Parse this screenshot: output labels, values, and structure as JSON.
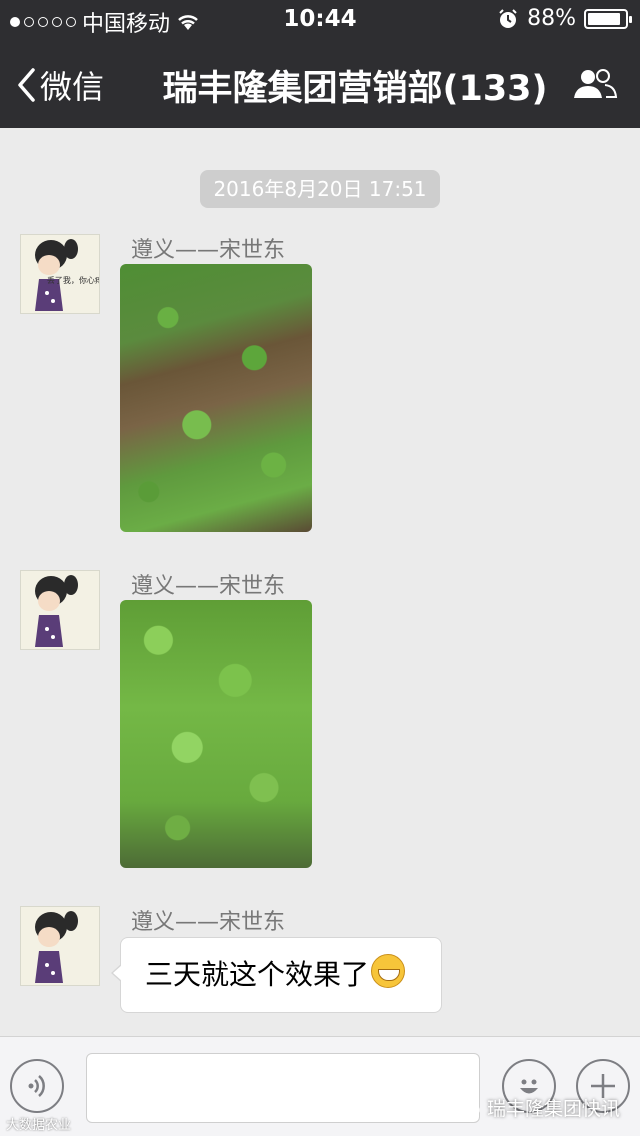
{
  "status_bar": {
    "carrier": "中国移动",
    "time": "10:44",
    "battery_percent": "88%",
    "battery_level": 0.88,
    "icons": [
      "signal-dots",
      "wifi-icon",
      "alarm-icon",
      "battery-icon"
    ]
  },
  "nav": {
    "back_label": "微信",
    "title": "瑞丰隆集团营销部(133)",
    "right_icon": "group-members-icon"
  },
  "chat": {
    "timestamp": "2016年8月20日 17:51",
    "messages": [
      {
        "sender": "遵义——宋世东",
        "type": "image",
        "image_desc": "seedlings-in-soil-photo"
      },
      {
        "sender": "遵义——宋世东",
        "type": "image",
        "image_desc": "dense-greens-photo"
      },
      {
        "sender": "遵义——宋世东",
        "type": "text",
        "text": "三天就这个效果了",
        "emoji": "grin-emoji"
      }
    ],
    "avatar_caption": "丢了我，你心疼吗?"
  },
  "input_bar": {
    "voice_icon": "voice-icon",
    "emoji_icon": "emoji-icon",
    "plus_icon": "plus-icon"
  },
  "watermark": {
    "right_text": "瑞丰隆集团快讯",
    "left_text": "大数据农业"
  },
  "colors": {
    "bar_bg": "#2e2e31",
    "chat_bg": "#ebebeb",
    "timestamp_bg": "#cecece"
  }
}
